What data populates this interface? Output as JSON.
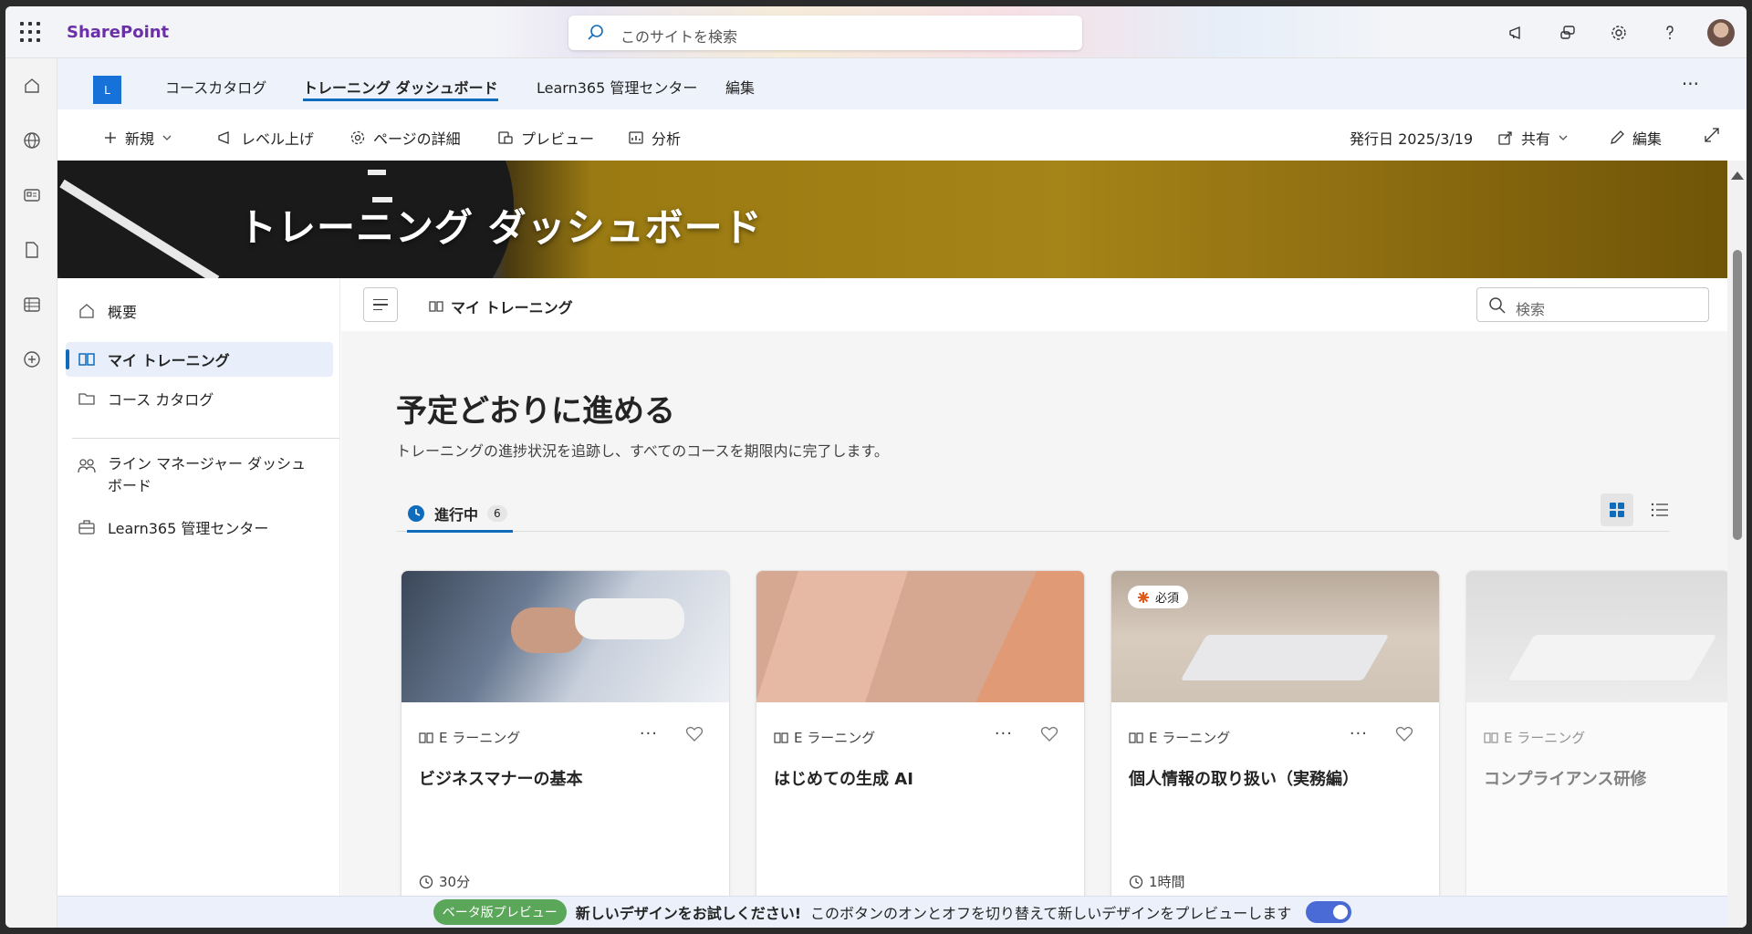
{
  "suite": {
    "brand": "SharePoint",
    "search_placeholder": "このサイトを検索"
  },
  "site_nav": {
    "logo_letter": "L",
    "tabs": [
      {
        "label": "コースカタログ"
      },
      {
        "label": "トレーニング ダッシュボード",
        "active": true
      },
      {
        "label": "Learn365 管理センター"
      },
      {
        "label": "編集"
      }
    ]
  },
  "command_bar": {
    "new": "新規",
    "promote": "レベル上げ",
    "page_details": "ページの詳細",
    "preview": "プレビュー",
    "analytics": "分析",
    "published": "発行日 2025/3/19",
    "share": "共有",
    "edit": "編集"
  },
  "banner": {
    "title": "トレーニング ダッシュボード"
  },
  "left_nav": {
    "items": [
      {
        "label": "概要"
      },
      {
        "label": "マイ トレーニング",
        "active": true
      },
      {
        "label": "コース カタログ"
      },
      {
        "label": "ライン マネージャー ダッシュボード"
      },
      {
        "label": "Learn365 管理センター"
      }
    ]
  },
  "main": {
    "breadcrumb": "マイ トレーニング",
    "search_placeholder": "検索",
    "heading": "予定どおりに進める",
    "subheading": "トレーニングの進捗状況を追跡し、すべてのコースを期限内に完了します。",
    "tab_label": "進行中",
    "tab_count": "6",
    "cards": [
      {
        "type": "E ラーニング",
        "title": "ビジネスマナーの基本",
        "duration": "30分",
        "more": "···"
      },
      {
        "type": "E ラーニング",
        "title": "はじめての生成 AI",
        "duration": "",
        "more": "···"
      },
      {
        "type": "E ラーニング",
        "title": "個人情報の取り扱い（実務編）",
        "duration": "1時間",
        "more": "···",
        "required": "必須"
      },
      {
        "type": "E ラーニング",
        "title": "コンプライアンス研修",
        "duration": ""
      }
    ]
  },
  "beta_bar": {
    "pill": "ベータ版プレビュー",
    "bold": "新しいデザインをお試しください!",
    "text": "このボタンのオンとオフを切り替えて新しいデザインをプレビューします"
  },
  "colors": {
    "accent": "#0f6cbd",
    "brand": "#6b2fa8",
    "beta": "#5aa75a",
    "toggle": "#4a6bd6"
  }
}
